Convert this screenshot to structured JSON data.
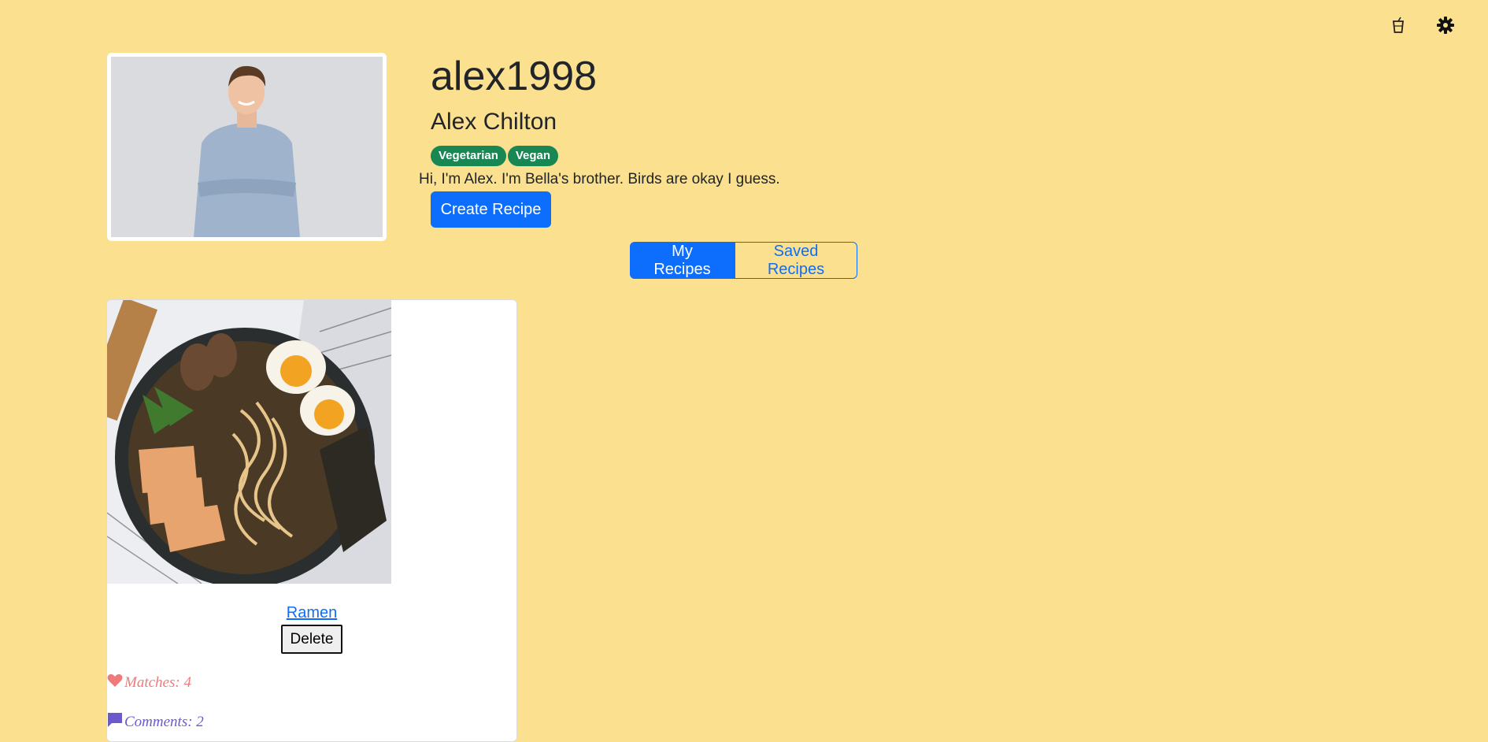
{
  "header": {
    "icons": [
      "drink-icon",
      "gear-icon"
    ]
  },
  "profile": {
    "username": "alex1998",
    "full_name": "Alex Chilton",
    "tags": [
      "Vegetarian",
      "Vegan"
    ],
    "bio": "Hi, I'm Alex. I'm Bella's brother. Birds are okay I guess.",
    "create_button": "Create Recipe"
  },
  "tabs": {
    "my_recipes": "My Recipes",
    "saved_recipes": "Saved Recipes",
    "active": "My Recipes"
  },
  "recipes": [
    {
      "name": "Ramen",
      "delete_label": "Delete",
      "matches": "Matches: 4",
      "comments": "Comments: 2"
    }
  ],
  "colors": {
    "background": "#fae08f",
    "primary": "#0d6efd",
    "badge": "#198754",
    "matches": "#ef7a7a",
    "comments": "#6a5acd"
  }
}
